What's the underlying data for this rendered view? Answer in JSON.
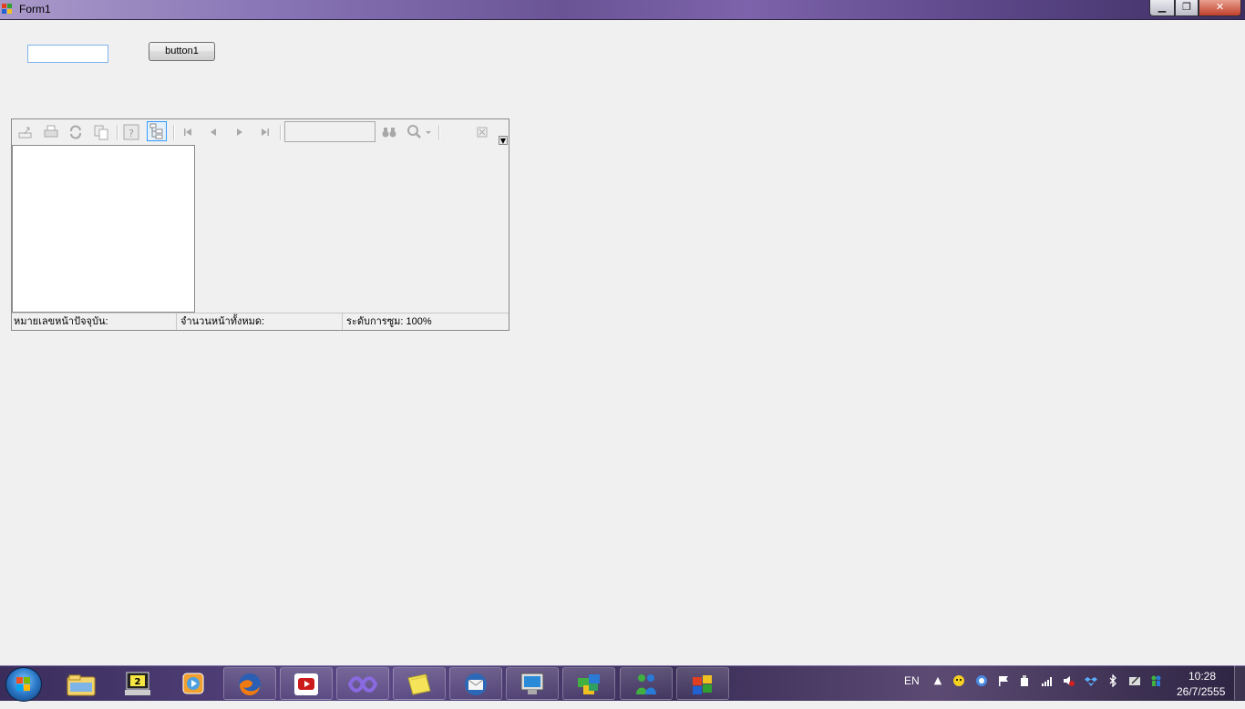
{
  "window": {
    "title": "Form1",
    "min_label": "▁",
    "max_label": "❐",
    "close_label": "✕"
  },
  "form": {
    "textbox_value": "",
    "button_label": "button1"
  },
  "viewer": {
    "toolbar": {
      "export_icon": "export-icon",
      "print_icon": "print-icon",
      "refresh_icon": "refresh-icon",
      "page_setup_icon": "page-setup-icon",
      "help_icon": "help-icon",
      "document_map_icon": "document-map-icon",
      "first_page_icon": "first-page-icon",
      "previous_page_icon": "previous-page-icon",
      "next_page_icon": "next-page-icon",
      "last_page_icon": "last-page-icon",
      "find_value": "",
      "binoculars_icon": "binoculars-icon",
      "zoom_icon": "zoom-icon",
      "close_icon": "close-icon"
    },
    "status": {
      "current_page": "หมายเลขหน้าปัจจุบัน:",
      "total_pages": "จำนวนหน้าทั้งหมด:",
      "zoom": "ระดับการซูม: 100%"
    }
  },
  "taskbar": {
    "apps": [
      {
        "icon": "windows-explorer-icon"
      },
      {
        "icon": "remote-desktop-icon",
        "badge": "2"
      },
      {
        "icon": "media-player-icon"
      },
      {
        "icon": "firefox-icon"
      },
      {
        "icon": "youtube-icon"
      },
      {
        "icon": "visual-studio-icon"
      },
      {
        "icon": "sticky-notes-icon"
      },
      {
        "icon": "thunderbird-icon"
      },
      {
        "icon": "computer-screen-icon"
      },
      {
        "icon": "puzzle-app-icon"
      },
      {
        "icon": "messenger-icon"
      },
      {
        "icon": "form-app-icon"
      }
    ],
    "language": "EN",
    "time": "10:28",
    "date": "26/7/2555"
  },
  "colors": {
    "form_background": "#f0f0f0",
    "textbox_border": "#7eb4ea",
    "active_button_border": "#3399ff"
  }
}
